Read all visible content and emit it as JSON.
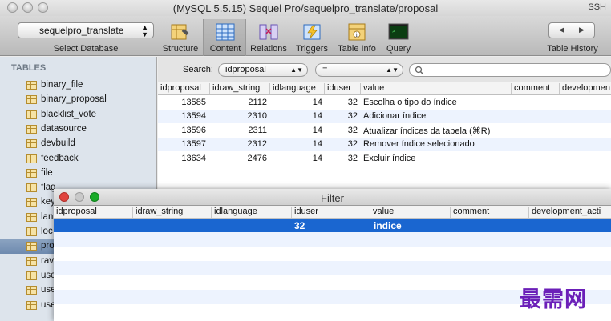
{
  "window": {
    "title": "(MySQL 5.5.15) Sequel Pro/sequelpro_translate/proposal",
    "ssh_label": "SSH"
  },
  "toolbar": {
    "database": "sequelpro_translate",
    "select_database_label": "Select Database",
    "buttons": [
      {
        "label": "Structure",
        "icon": "structure-icon"
      },
      {
        "label": "Content",
        "icon": "content-icon"
      },
      {
        "label": "Relations",
        "icon": "relations-icon"
      },
      {
        "label": "Triggers",
        "icon": "triggers-icon"
      },
      {
        "label": "Table Info",
        "icon": "table-info-icon"
      },
      {
        "label": "Query",
        "icon": "query-icon"
      }
    ],
    "history_label": "Table History"
  },
  "sidebar": {
    "heading": "TABLES",
    "items": [
      {
        "label": "binary_file"
      },
      {
        "label": "binary_proposal"
      },
      {
        "label": "blacklist_vote"
      },
      {
        "label": "datasource"
      },
      {
        "label": "devbuild"
      },
      {
        "label": "feedback"
      },
      {
        "label": "file"
      },
      {
        "label": "flag"
      },
      {
        "label": "key"
      },
      {
        "label": "lan"
      },
      {
        "label": "loc"
      },
      {
        "label": "pro"
      },
      {
        "label": "rav"
      },
      {
        "label": "use"
      },
      {
        "label": "use"
      },
      {
        "label": "use"
      }
    ]
  },
  "filter": {
    "search_label": "Search:",
    "field": "idproposal",
    "operator": "="
  },
  "grid": {
    "columns": [
      "idproposal",
      "idraw_string",
      "idlanguage",
      "iduser",
      "value",
      "comment",
      "developmen"
    ],
    "rows": [
      {
        "idproposal": "13585",
        "idraw_string": "2112",
        "idlanguage": "14",
        "iduser": "32",
        "value": "Escolha o tipo do índice"
      },
      {
        "idproposal": "13594",
        "idraw_string": "2310",
        "idlanguage": "14",
        "iduser": "32",
        "value": "Adicionar índice"
      },
      {
        "idproposal": "13596",
        "idraw_string": "2311",
        "idlanguage": "14",
        "iduser": "32",
        "value": "Atualizar índices da tabela (⌘R)"
      },
      {
        "idproposal": "13597",
        "idraw_string": "2312",
        "idlanguage": "14",
        "iduser": "32",
        "value": "Remover índice selecionado"
      },
      {
        "idproposal": "13634",
        "idraw_string": "2476",
        "idlanguage": "14",
        "iduser": "32",
        "value": "Excluir índice"
      }
    ]
  },
  "filter_window": {
    "title": "Filter",
    "columns": [
      "idproposal",
      "idraw_string",
      "idlanguage",
      "iduser",
      "value",
      "comment",
      "development_acti"
    ],
    "selected_row": {
      "iduser": "32",
      "value": "indice"
    }
  },
  "watermark": "最需网",
  "colors": {
    "selection": "#1a66d0",
    "sidebar_bg": "#dde4ec",
    "close": "#e0443e",
    "minimize": "#dea123",
    "zoom": "#1aab29"
  }
}
